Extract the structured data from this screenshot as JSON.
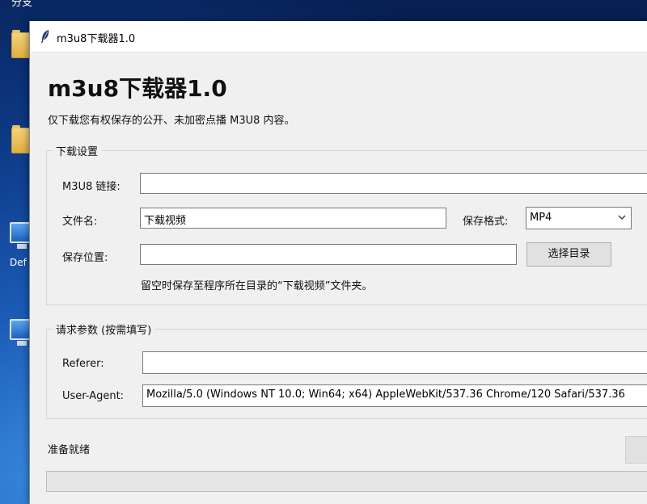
{
  "desktop": {
    "top_label": "分支",
    "icon_label_monitor": "Def"
  },
  "window": {
    "title": "m3u8下载器1.0"
  },
  "app": {
    "heading": "m3u8下载器1.0",
    "subtitle": "仅下载您有权保存的公开、未加密点播 M3U8 内容。"
  },
  "download_settings": {
    "legend": "下载设置",
    "m3u8_label": "M3U8 链接:",
    "m3u8_value": "",
    "filename_label": "文件名:",
    "filename_value": "下载视频",
    "format_label": "保存格式:",
    "format_selected": "MP4",
    "location_label": "保存位置:",
    "location_value": "",
    "choose_dir_button": "选择目录",
    "hint": "留空时保存至程序所在目录的“下载视频”文件夹。"
  },
  "request_params": {
    "legend": "请求参数 (按需填写)",
    "referer_label": "Referer:",
    "referer_value": "",
    "ua_label": "User-Agent:",
    "ua_value": "Mozilla/5.0 (Windows NT 10.0; Win64; x64) AppleWebKit/537.36 Chrome/120 Safari/537.36"
  },
  "status": {
    "text": "准备就绪",
    "progress_percent": 0
  }
}
